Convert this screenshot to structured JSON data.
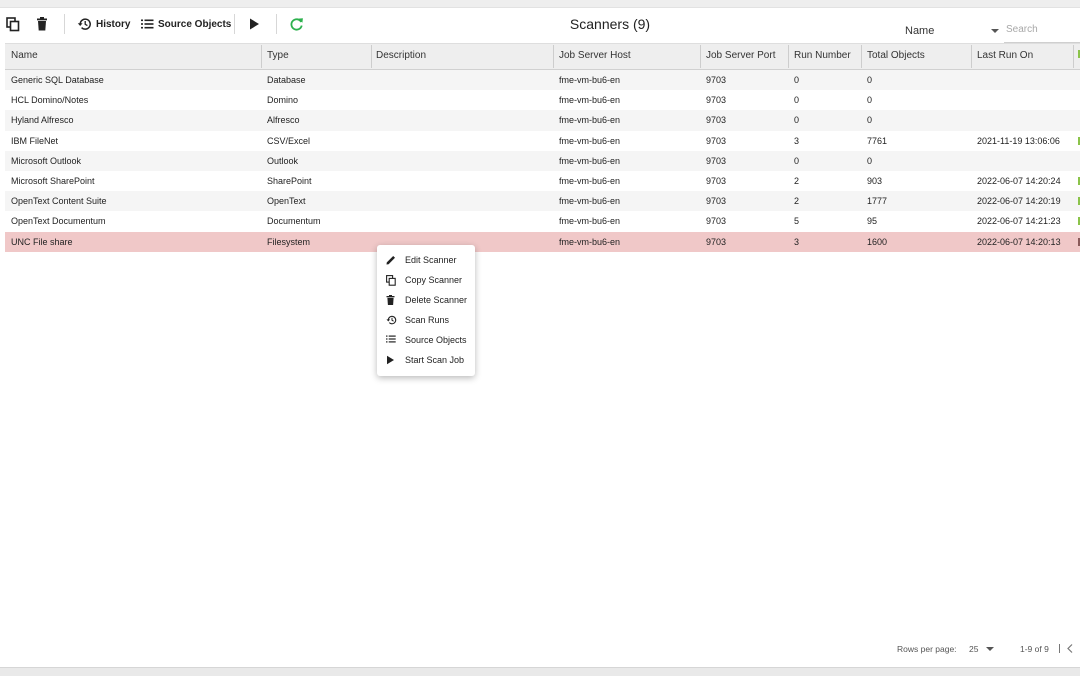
{
  "toolbar": {
    "history_label": "History",
    "source_objects_label": "Source Objects",
    "title": "Scanners (9)",
    "sort_value": "Name",
    "search_placeholder": "Search",
    "refresh_color": "#2db14e"
  },
  "table": {
    "columns": [
      "Name",
      "Type",
      "Description",
      "Job Server Host",
      "Job Server Port",
      "Run Number",
      "Total Objects",
      "Last Run On"
    ],
    "rows": [
      {
        "name": "Generic SQL Database",
        "type": "Database",
        "description": "",
        "host": "fme-vm-bu6-en",
        "port": "9703",
        "run_number": "0",
        "total_objects": "0",
        "last_run": ""
      },
      {
        "name": "HCL Domino/Notes",
        "type": "Domino",
        "description": "",
        "host": "fme-vm-bu6-en",
        "port": "9703",
        "run_number": "0",
        "total_objects": "0",
        "last_run": ""
      },
      {
        "name": "Hyland Alfresco",
        "type": "Alfresco",
        "description": "",
        "host": "fme-vm-bu6-en",
        "port": "9703",
        "run_number": "0",
        "total_objects": "0",
        "last_run": ""
      },
      {
        "name": "IBM FileNet",
        "type": "CSV/Excel",
        "description": "",
        "host": "fme-vm-bu6-en",
        "port": "9703",
        "run_number": "3",
        "total_objects": "7761",
        "last_run": "2021-11-19 13:06:06"
      },
      {
        "name": "Microsoft Outlook",
        "type": "Outlook",
        "description": "",
        "host": "fme-vm-bu6-en",
        "port": "9703",
        "run_number": "0",
        "total_objects": "0",
        "last_run": ""
      },
      {
        "name": "Microsoft SharePoint",
        "type": "SharePoint",
        "description": "",
        "host": "fme-vm-bu6-en",
        "port": "9703",
        "run_number": "2",
        "total_objects": "903",
        "last_run": "2022-06-07 14:20:24"
      },
      {
        "name": "OpenText Content Suite",
        "type": "OpenText",
        "description": "",
        "host": "fme-vm-bu6-en",
        "port": "9703",
        "run_number": "2",
        "total_objects": "1777",
        "last_run": "2022-06-07 14:20:19"
      },
      {
        "name": "OpenText Documentum",
        "type": "Documentum",
        "description": "",
        "host": "fme-vm-bu6-en",
        "port": "9703",
        "run_number": "5",
        "total_objects": "95",
        "last_run": "2022-06-07 14:21:23"
      },
      {
        "name": "UNC File share",
        "type": "Filesystem",
        "description": "",
        "host": "fme-vm-bu6-en",
        "port": "9703",
        "run_number": "3",
        "total_objects": "1600",
        "last_run": "2022-06-07 14:20:13"
      }
    ],
    "selected_row_color": "#f0c8c8"
  },
  "context_menu": {
    "items": [
      {
        "label": "Edit Scanner",
        "icon": "pencil-icon"
      },
      {
        "label": "Copy Scanner",
        "icon": "copy-icon"
      },
      {
        "label": "Delete Scanner",
        "icon": "trash-icon"
      },
      {
        "label": "Scan Runs",
        "icon": "history-icon"
      },
      {
        "label": "Source Objects",
        "icon": "list-icon"
      },
      {
        "label": "Start Scan Job",
        "icon": "play-icon"
      }
    ]
  },
  "pagination": {
    "rows_per_page_label": "Rows per page:",
    "rows_per_page": "25",
    "range": "1-9 of 9"
  }
}
